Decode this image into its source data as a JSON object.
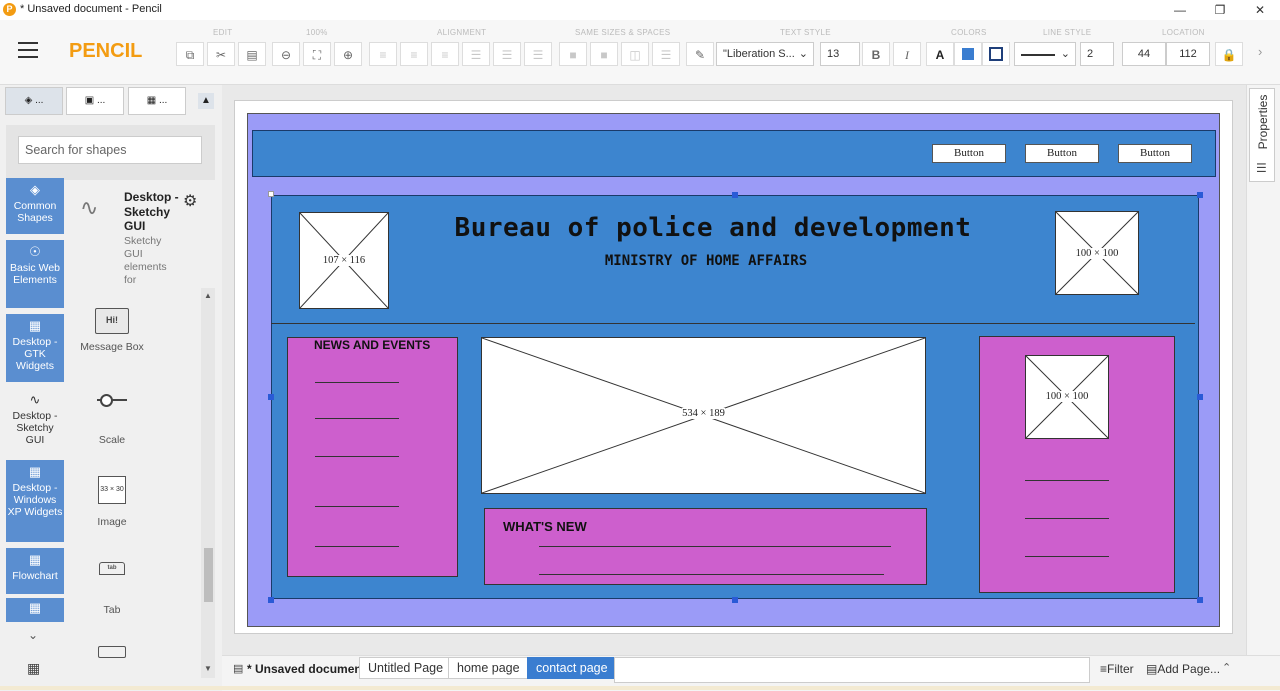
{
  "window": {
    "title": "* Unsaved document - Pencil",
    "app_icon": "P"
  },
  "toolbar": {
    "app_name": "PENCIL",
    "groups": {
      "edit": "EDIT",
      "zoom": "100%",
      "alignment": "ALIGNMENT",
      "same_sizes": "SAME SIZES & SPACES",
      "text_style": "TEXT STYLE",
      "colors": "COLORS",
      "line_style": "LINE STYLE",
      "location": "LOCATION"
    },
    "font_family": "\"Liberation S...",
    "font_size": "13",
    "bold_label": "B",
    "italic_label": "I",
    "text_color_label": "A",
    "line_width": "2",
    "location_x": "44",
    "location_y": "112",
    "fill_color": "#3a7dd0"
  },
  "sidebar": {
    "tabs": [
      "...",
      "...",
      "..."
    ],
    "search_placeholder": "Search for shapes",
    "categories": [
      {
        "label": "Common Shapes",
        "icon": "layers-icon"
      },
      {
        "label": "Basic Web Elements",
        "icon": "globe-icon"
      },
      {
        "label": "Desktop - GTK Widgets",
        "icon": "grid-icon"
      },
      {
        "label": "Desktop - Sketchy GUI",
        "icon": "squiggle-icon"
      },
      {
        "label": "Desktop - Windows XP Widgets",
        "icon": "grid-icon"
      },
      {
        "label": "Flowchart",
        "icon": "grid-icon"
      }
    ],
    "collection": {
      "title": "Desktop - Sketchy GUI",
      "description": "Sketchy GUI elements for"
    },
    "shapes": [
      {
        "label": "Message Box",
        "icon_text": "Hi!"
      },
      {
        "label": "Scale"
      },
      {
        "label": "Image",
        "icon_text": "33 × 30"
      },
      {
        "label": "Tab",
        "icon_text": "tab"
      }
    ]
  },
  "canvas": {
    "buttons": [
      "Button",
      "Button",
      "Button"
    ],
    "heading": "Bureau of police and development",
    "subheading": "MINISTRY OF HOME AFFAIRS",
    "img_left_label": "107 × 116",
    "img_right_label": "100 × 100",
    "news_title": "NEWS AND EVENTS",
    "main_image_label": "534 × 189",
    "whats_new_title": "WHAT'S NEW",
    "side_image_label": "100 × 100",
    "colors": {
      "outer": "#9b9bf7",
      "header_bar": "#3d85cf",
      "body": "#3d85cf",
      "pink": "#cd5fcd"
    }
  },
  "right_panel": {
    "label": "Properties"
  },
  "bottom": {
    "doc_label": "* Unsaved document",
    "pages": [
      "Untitled Page",
      "home page",
      "contact page"
    ],
    "active_page": "contact page",
    "filter_label": "Filter",
    "add_page_label": "Add Page..."
  }
}
